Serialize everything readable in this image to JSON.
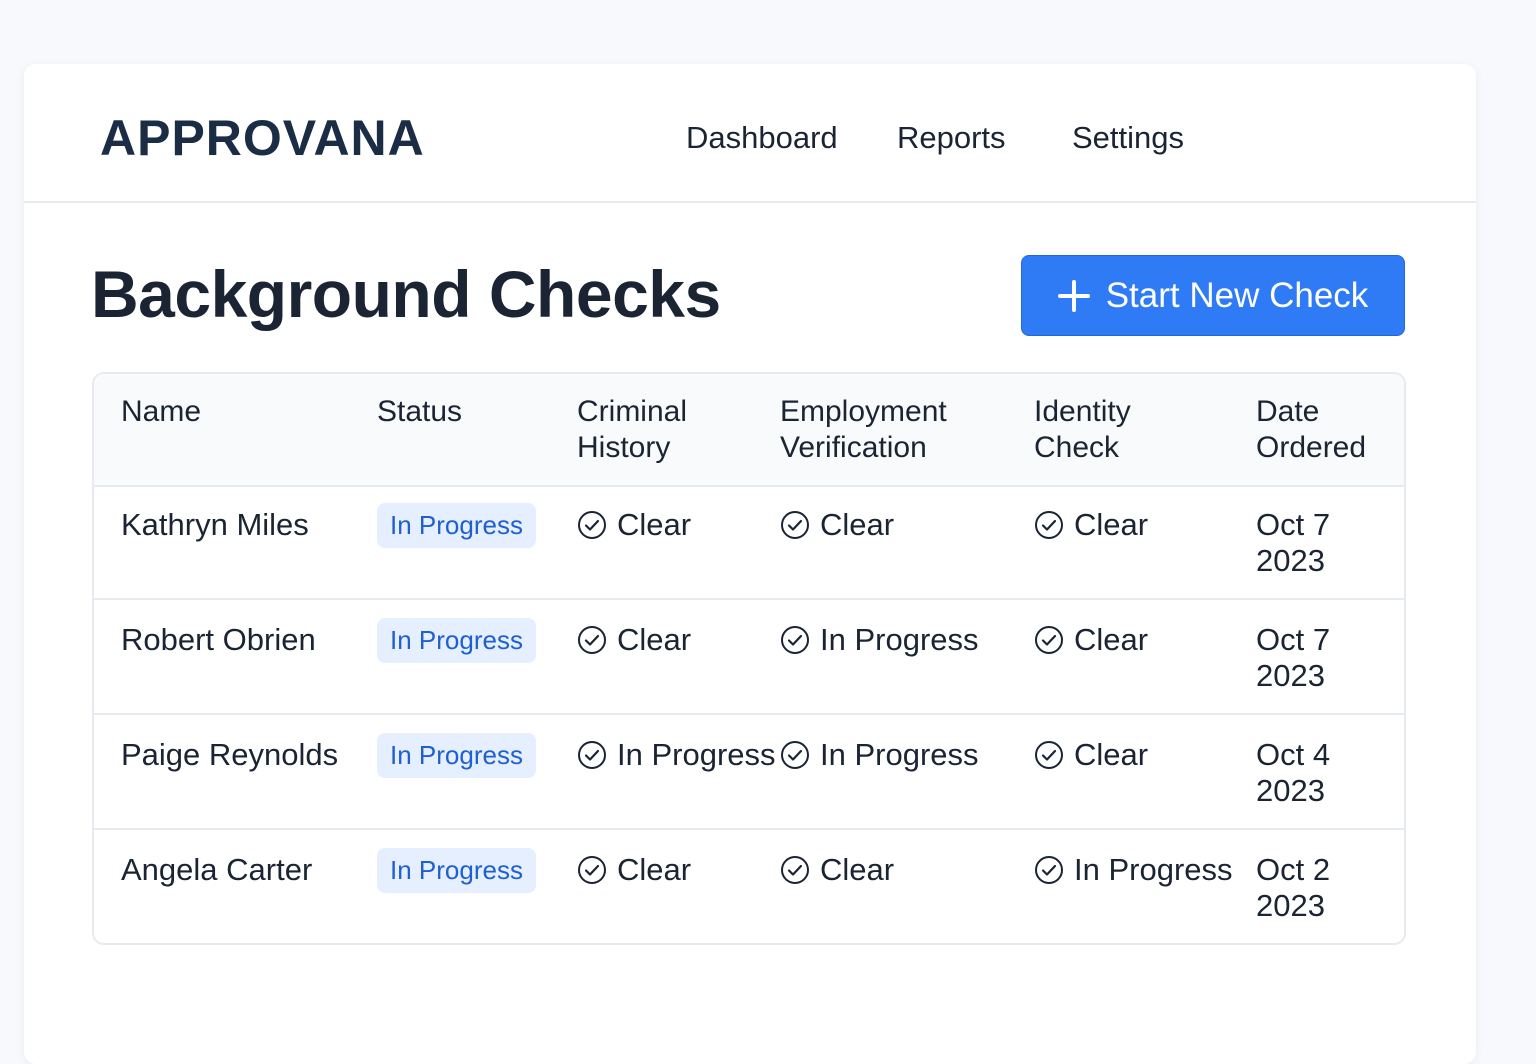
{
  "app": {
    "logo": "APPROVANA"
  },
  "nav": {
    "dashboard": "Dashboard",
    "reports": "Reports",
    "settings": "Settings"
  },
  "page": {
    "title": "Background Checks",
    "start_button_label": "Start New Check"
  },
  "table": {
    "headers": {
      "name": "Name",
      "status": "Status",
      "criminal_line1": "Criminal",
      "criminal_line2": "History",
      "employment_line1": "Employment",
      "employment_line2": "Verification",
      "identity_line1": "Identity",
      "identity_line2": "Check",
      "date_line1": "Date",
      "date_line2": "Ordered"
    },
    "rows": [
      {
        "name": "Kathryn Miles",
        "status": "In Progress",
        "criminal": "Clear",
        "employment": "Clear",
        "identity": "Clear",
        "date_line1": "Oct 7",
        "date_line2": "2023"
      },
      {
        "name": "Robert Obrien",
        "status": "In Progress",
        "criminal": "Clear",
        "employment": "In Progress",
        "identity": "Clear",
        "date_line1": "Oct 7",
        "date_line2": "2023"
      },
      {
        "name": "Paige Reynolds",
        "status": "In Progress",
        "criminal": "In Progress",
        "employment": "In Progress",
        "identity": "Clear",
        "date_line1": "Oct 4",
        "date_line2": "2023"
      },
      {
        "name": "Angela Carter",
        "status": "In Progress",
        "criminal": "Clear",
        "employment": "Clear",
        "identity": "In Progress",
        "date_line1": "Oct 2",
        "date_line2": "2023"
      }
    ]
  },
  "icons": {
    "check": "check-circle-icon",
    "plus": "plus-icon"
  },
  "colors": {
    "accent": "#2f7bf5",
    "badge_bg": "#e5efff",
    "badge_text": "#1e5fd2"
  }
}
